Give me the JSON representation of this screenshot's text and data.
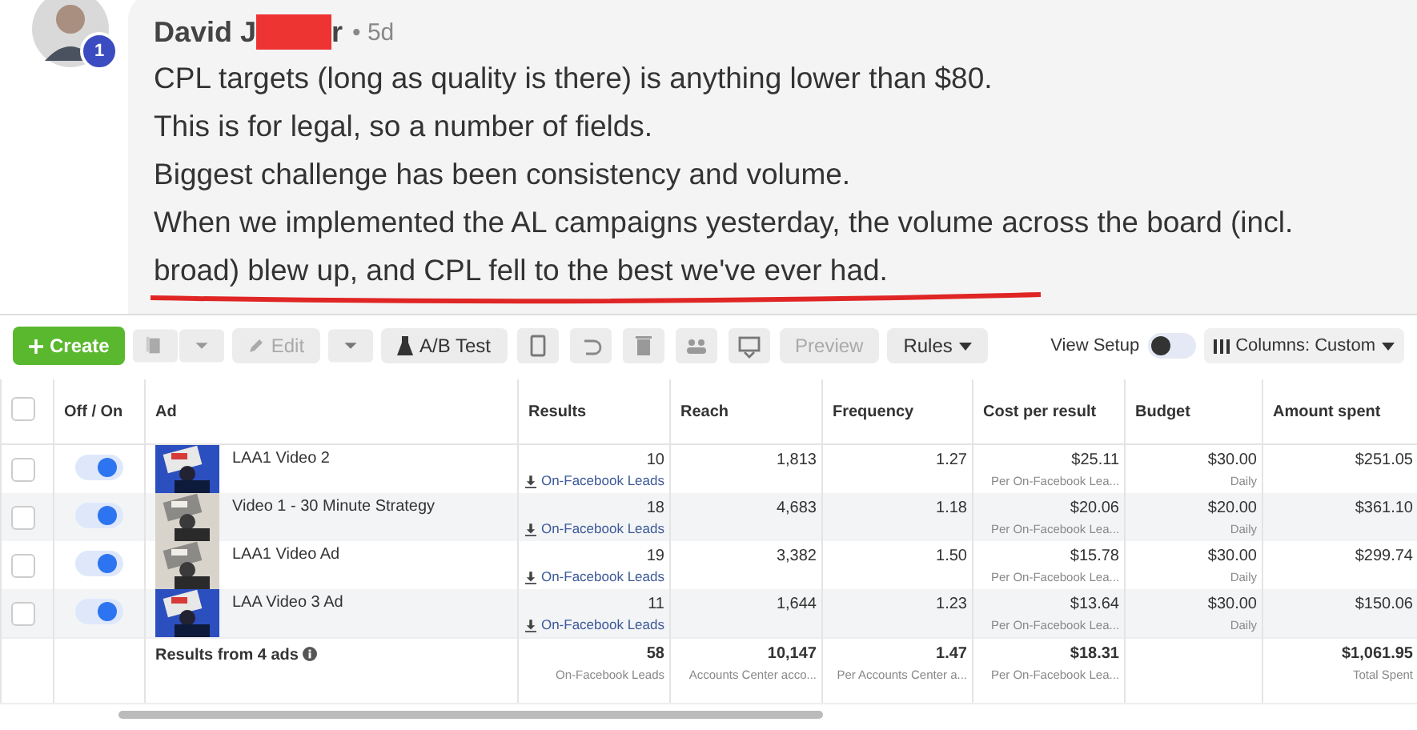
{
  "comment": {
    "author": "David J",
    "author_tail": "r",
    "time": "• 5d",
    "badge": "1",
    "lines": [
      "CPL targets (long as quality is there) is anything lower than $80.",
      "This is for legal, so a number of fields.",
      "Biggest challenge has been consistency and volume.",
      "When we implemented the AL campaigns yesterday, the volume across the board (incl.",
      "broad) blew up, and CPL fell to the best we've ever had."
    ]
  },
  "toolbar": {
    "create": {
      "label": "Create",
      "disabled": false
    },
    "edit": {
      "label": "Edit",
      "disabled": true
    },
    "ab_test": {
      "label": "A/B Test",
      "disabled": false
    },
    "preview": {
      "label": "Preview",
      "disabled": true
    },
    "rules": {
      "label": "Rules",
      "disabled": false
    },
    "view_setup": {
      "label": "View Setup",
      "on": false
    },
    "columns": "Columns: Custom"
  },
  "table": {
    "select_all_checked": false,
    "columns": [
      "Off / On",
      "Ad",
      "Results",
      "Reach",
      "Frequency",
      "Cost per result",
      "Budget",
      "Amount spent"
    ],
    "rows": [
      {
        "checked": false,
        "on": true,
        "ad": "LAA1 Video 2",
        "results": "10",
        "result_type": "On-Facebook Leads",
        "reach": "1,813",
        "frequency": "1.27",
        "cost": "$25.11",
        "cost_type": "Per On-Facebook Lea...",
        "budget": "$30.00",
        "budget_type": "Daily",
        "spent": "$251.05"
      },
      {
        "checked": false,
        "on": true,
        "ad": "Video 1 - 30 Minute Strategy",
        "results": "18",
        "result_type": "On-Facebook Leads",
        "reach": "4,683",
        "frequency": "1.18",
        "cost": "$20.06",
        "cost_type": "Per On-Facebook Lea...",
        "budget": "$20.00",
        "budget_type": "Daily",
        "spent": "$361.10"
      },
      {
        "checked": false,
        "on": true,
        "ad": "LAA1 Video Ad",
        "results": "19",
        "result_type": "On-Facebook Leads",
        "reach": "3,382",
        "frequency": "1.50",
        "cost": "$15.78",
        "cost_type": "Per On-Facebook Lea...",
        "budget": "$30.00",
        "budget_type": "Daily",
        "spent": "$299.74"
      },
      {
        "checked": false,
        "on": true,
        "ad": "LAA Video 3 Ad",
        "results": "11",
        "result_type": "On-Facebook Leads",
        "reach": "1,644",
        "frequency": "1.23",
        "cost": "$13.64",
        "cost_type": "Per On-Facebook Lea...",
        "budget": "$30.00",
        "budget_type": "Daily",
        "spent": "$150.06"
      }
    ],
    "summary": {
      "label": "Results from 4 ads",
      "results": "58",
      "result_type": "On-Facebook Leads",
      "reach": "10,147",
      "reach_type": "Accounts Center acco...",
      "frequency": "1.47",
      "frequency_type": "Per Accounts Center a...",
      "cost": "$18.31",
      "cost_type": "Per On-Facebook Lea...",
      "spent": "$1,061.95",
      "spent_type": "Total Spent"
    }
  }
}
